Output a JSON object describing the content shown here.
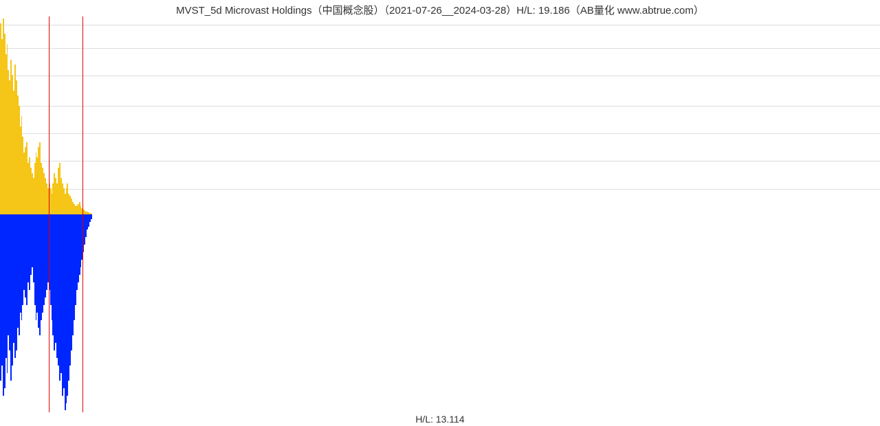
{
  "title": "MVST_5d Microvast Holdings（中国概念股）（2021-07-26__2024-03-28）H/L: 19.186（AB量化  www.abtrue.com）",
  "hl_label": "H/L: 13.114",
  "chart_data": {
    "type": "bar",
    "title": "MVST_5d Microvast Holdings（中国概念股）（2021-07-26__2024-03-28）H/L: 19.186",
    "xlabel": "",
    "ylabel": "",
    "ylim_up": [
      0,
      19.186
    ],
    "ylim_dn": [
      0,
      13.114
    ],
    "note": "Upper (yellow) bars rise from center; lower (blue) bars descend from center. Red vertical lines at indices ~37 and ~63. Data occupies roughly first 70 of ~670 5-day periods.",
    "grid_levels_pct_from_top": [
      2,
      8,
      15,
      22.5,
      29.5,
      36.5,
      43.5
    ],
    "up_values": [
      18.5,
      17.0,
      19.0,
      17.5,
      15.5,
      16.5,
      14.0,
      13.0,
      15.0,
      13.5,
      12.0,
      14.5,
      13.0,
      11.5,
      10.5,
      8.5,
      9.5,
      7.5,
      6.0,
      6.5,
      7.0,
      5.0,
      5.5,
      4.5,
      4.0,
      3.5,
      5.0,
      6.0,
      5.5,
      6.5,
      7.0,
      5.0,
      4.5,
      4.0,
      3.5,
      3.0,
      2.5,
      3.0,
      2.5,
      2.0,
      3.0,
      4.0,
      3.5,
      3.0,
      4.5,
      5.0,
      3.5,
      3.0,
      2.5,
      2.0,
      2.5,
      3.0,
      2.0,
      1.8,
      1.5,
      1.2,
      1.0,
      0.8,
      0.9,
      1.0,
      1.2,
      0.8,
      0.6,
      0.5,
      0.4,
      0.3,
      0.25,
      0.2,
      0.15,
      0.1
    ],
    "dn_values": [
      11.0,
      10.0,
      12.0,
      11.5,
      9.5,
      10.5,
      8.0,
      9.0,
      11.0,
      10.0,
      8.5,
      9.5,
      9.0,
      7.5,
      8.0,
      6.5,
      7.0,
      6.0,
      5.0,
      5.5,
      6.0,
      4.5,
      5.0,
      4.0,
      3.5,
      4.5,
      6.0,
      7.0,
      6.5,
      7.5,
      8.0,
      7.0,
      6.5,
      6.0,
      5.5,
      5.0,
      4.5,
      5.0,
      6.0,
      7.0,
      8.0,
      9.0,
      8.5,
      9.5,
      10.0,
      11.0,
      10.5,
      12.0,
      11.5,
      13.0,
      12.5,
      12.0,
      11.0,
      10.0,
      9.0,
      8.0,
      7.0,
      6.0,
      5.0,
      4.5,
      4.0,
      3.5,
      3.0,
      2.5,
      2.0,
      1.5,
      1.0,
      0.8,
      0.5,
      0.3
    ],
    "red_marker_indices": [
      37,
      63
    ],
    "total_x_slots": 670
  }
}
